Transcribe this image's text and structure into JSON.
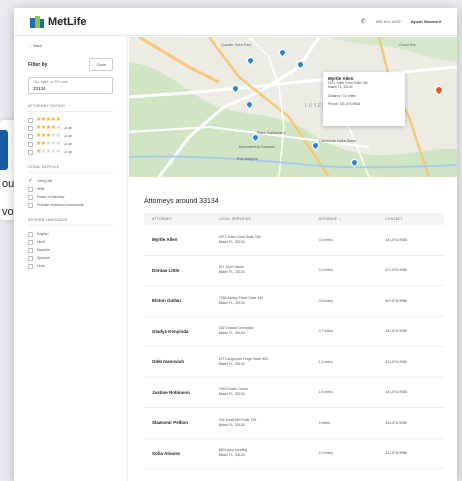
{
  "background": {
    "text_line_1": "ou",
    "text_line_2": "vor"
  },
  "header": {
    "brand": "MetLife",
    "phone": "800-621-6435",
    "user": "Ayush Saxena",
    "user_caret": "▾"
  },
  "sidebar": {
    "back": "← Back",
    "filter_title": "Filter by",
    "clear_label": "Clear",
    "location_placeholder": "City, state, or ZIP code",
    "location_value": "33134",
    "rating_title": "ATTORNEY RATING",
    "ratings": [
      {
        "stars": 5,
        "label": ""
      },
      {
        "stars": 4,
        "label": "& up"
      },
      {
        "stars": 3,
        "label": "& up"
      },
      {
        "stars": 2,
        "label": "& up"
      },
      {
        "stars": 1,
        "label": "& up"
      }
    ],
    "legal_title": "LEGAL SERVICE",
    "legal_options": [
      {
        "label": "Living will",
        "checked": true
      },
      {
        "label": "Wills",
        "checked": false
      },
      {
        "label": "Power of attorney",
        "checked": false
      },
      {
        "label": "Probate residence documents",
        "checked": false
      }
    ],
    "language_title": "SPOKEN LANGUAGE",
    "languages": [
      {
        "label": "English",
        "checked": false
      },
      {
        "label": "Hindi",
        "checked": false
      },
      {
        "label": "Mandrin",
        "checked": false
      },
      {
        "label": "Spanish",
        "checked": false
      },
      {
        "label": "Urdu",
        "checked": false
      }
    ]
  },
  "map": {
    "card": {
      "name": "Myrtle Allen",
      "address_line1": "9372 Juliet Crest Suite 336",
      "address_line2": "Miami FL, 33134",
      "distance": "Distance: 0.2 miles",
      "phone": "Phone: 331-876-9988"
    },
    "labels": {
      "top_left": "Quartier Saint-Paul",
      "top_right": "Grand Rue",
      "middle": "Place Guillaume II",
      "mid_right": "Cathédrale Notre-Dame",
      "lower": "Monument du Souvenir",
      "bottom": "Pont Adolphe",
      "district": "LUXEMBOURG"
    },
    "pin_color": "#2b86d8",
    "active_pin_color": "#e05a2b"
  },
  "results": {
    "title": "Attorneys around 33134",
    "columns": [
      "ATTORNEY",
      "LEGAL SERVICES",
      "DISTANCE ⌄",
      "CONTACT"
    ],
    "rows": [
      {
        "name": "Myrtle Allen",
        "addr1": "9372 Juliet Crest Suite 336",
        "addr2": "Miami FL, 33134",
        "distance": "0.2 miles",
        "contact": "331-876-9988"
      },
      {
        "name": "Dontae Little",
        "addr1": "627 June Haven",
        "addr2": "Miami FL, 33134",
        "distance": "0.3 miles",
        "contact": "671-876-9988"
      },
      {
        "name": "Elston Gullan",
        "addr1": "7268 Ashley Place Suite 344",
        "addr2": "Miami FL, 33134",
        "distance": "0.6 miles",
        "contact": "602-876-9988"
      },
      {
        "name": "Gladys Kenyinda",
        "addr1": "392 Chance Overpass",
        "addr2": "Miami FL, 33134",
        "distance": "0.7 miles",
        "contact": "331-876-9988"
      },
      {
        "name": "Gleb Ivanovich",
        "addr1": "127 Langworth Forge Suite 406",
        "addr2": "Miami FL, 33134",
        "distance": "1.2 miles",
        "contact": "331-876-9988"
      },
      {
        "name": "Justine Robinson",
        "addr1": "7992 Dovie Corner",
        "addr2": "Miami FL, 33134",
        "distance": "1.5 miles",
        "contact": "331-876-9988"
      },
      {
        "name": "Slawomir Pellion",
        "addr1": "016 Yundt Mill Suite 136",
        "addr2": "Miami FL, 33134",
        "distance": "2 miles",
        "contact": "331-876-9988"
      },
      {
        "name": "Sofia Alvarez",
        "addr1": "660 Lakin Landing",
        "addr2": "Miami FL, 33134",
        "distance": "2.2 miles",
        "contact": "331-876-9988"
      }
    ]
  }
}
